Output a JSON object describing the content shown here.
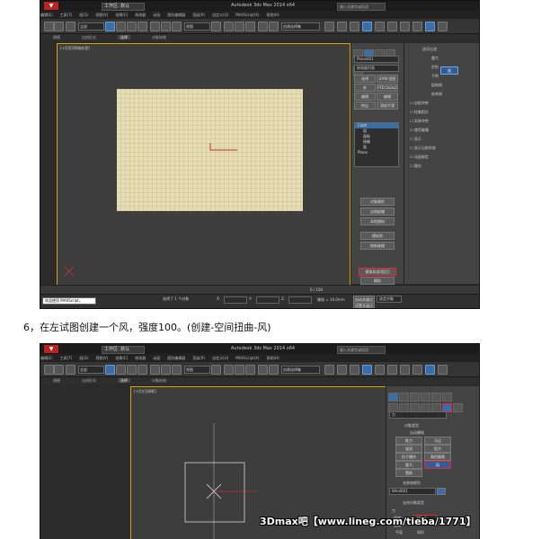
{
  "caption": "6，在左试图创建一个风，强度100。(创建-空间扭曲-风)",
  "watermark": "3Dmax吧【www.lineg.com/tieba/1771】",
  "shot1": {
    "app_title": "Autodesk 3ds Max 2014 x64",
    "workspace": "工作区: 默认",
    "search_placeholder": "键入关键字或短语",
    "menu_items": [
      "编辑(E)",
      "工具(T)",
      "组(G)",
      "视图(V)",
      "创建(C)",
      "修改器",
      "动画",
      "图形编辑器",
      "渲染(R)",
      "自定义(U)",
      "MAXScript(X)",
      "帮助(H)"
    ],
    "ribbon_tabs": [
      "建模",
      "自由形式",
      "选择",
      "对象绘制"
    ],
    "viewport_label": "[+][顶][明暗处理]",
    "panel": {
      "object_name": "Plane001",
      "modifier_list": "修改器列表",
      "buttons": [
        "选择",
        "UVW 贴图",
        "补",
        "FFD 2x2x2",
        "编辑",
        "编辑",
        "挤出",
        "涡轮平滑"
      ],
      "stack_items": [
        "Cloth",
        "组",
        "面板",
        "接缝",
        "面",
        "Plane"
      ],
      "bottom_buttons": [
        "对象属性",
        "自相碰撞",
        "本地模拟",
        "模拟到",
        "刷新碰撞",
        "模拟局部(阻尼)",
        "模拟"
      ],
      "rollout_title": "选项过滤",
      "rollout_items": [
        "重力",
        "步阶",
        "子例",
        "起始帧",
        "结束帧",
        "自相冲突",
        "检查相交",
        "实体冲突",
        "使用碰撞",
        "显示",
        "显示当前状态",
        "动画绑定",
        "缓存"
      ]
    },
    "status": {
      "script_label": "欢迎使用 MAXScript。",
      "selected": "选择了 1 个对象",
      "frame": "0 / 100",
      "x_label": "X:",
      "y_label": "Y:",
      "z_label": "Z:",
      "grid": "栅格 = 10.0mm",
      "auto_key": "自动关键点",
      "set_key": "设置关键点",
      "select_filter": "选定对象"
    }
  },
  "shot2": {
    "app_title": "Autodesk 3ds Max 2014 x64",
    "workspace": "工作区: 默认",
    "search_placeholder": "键入关键字或短语",
    "menu_items": [
      "编辑(E)",
      "工具(T)",
      "组(G)",
      "视图(V)",
      "创建(C)",
      "修改器",
      "动画",
      "图形编辑器",
      "渲染(R)",
      "自定义(U)",
      "MAXScript(X)",
      "帮助(H)"
    ],
    "ribbon_tabs": [
      "建模",
      "自由形式",
      "选择",
      "对象绘制"
    ],
    "viewport_label": "[+][左][线框]",
    "panel": {
      "section_object_type": "对象类型",
      "auto_grid": "自动栅格",
      "buttons": [
        "推力",
        "马达",
        "漩涡",
        "阻力",
        "粒子爆炸",
        "路径跟随",
        "重力",
        "风",
        "置换"
      ],
      "section_name_color": "名称和颜色",
      "object_name": "Wind001",
      "section_params": "支持对象类型",
      "force_label": "力",
      "strength_label": "强度:",
      "strength_value": "100.0",
      "decay_label": "衰减:",
      "plane_label": "平面",
      "sphere_label": "球形"
    }
  }
}
